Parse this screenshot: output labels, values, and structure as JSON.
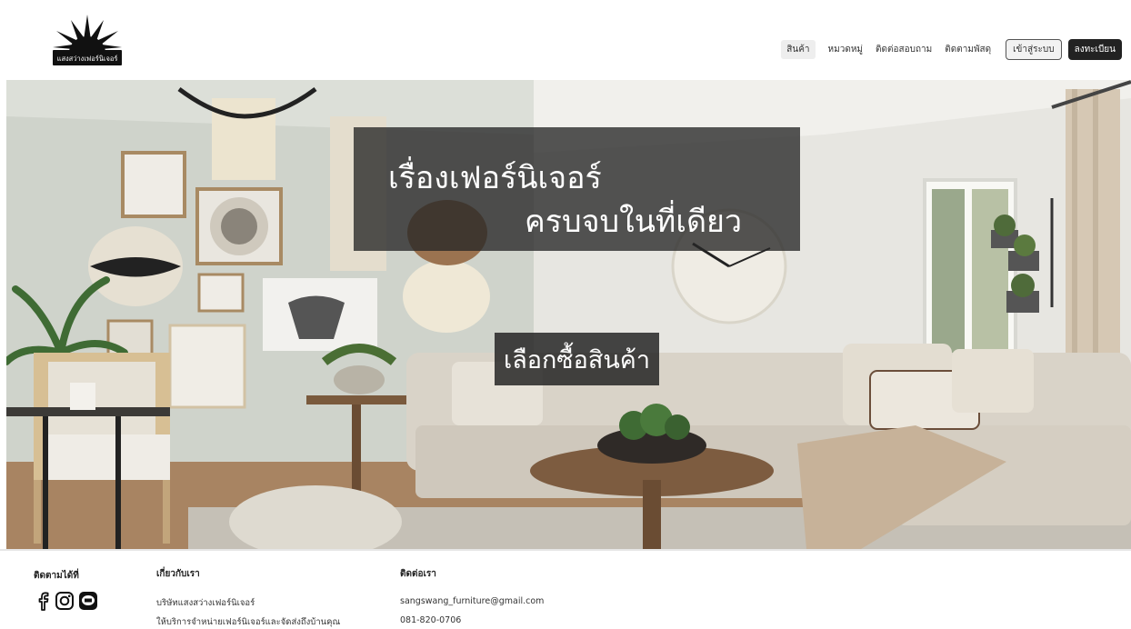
{
  "header": {
    "logo_text": "แสงสว่างเฟอร์นิเจอร์",
    "nav": [
      "สินค้า",
      "หมวดหมู่",
      "ติดต่อสอบถาม",
      "ติดตามพัสดุ"
    ],
    "login_label": "เข้าสู่ระบบ",
    "register_label": "ลงทะเบียน"
  },
  "hero": {
    "headline_line1": "เรื่องเฟอร์นิเจอร์",
    "headline_line2": "ครบจบในที่เดียว",
    "cta_label": "เลือกซื้อสินค้า"
  },
  "footer": {
    "follow_title": "ติดตามได้ที่",
    "social_icons": [
      "facebook-icon",
      "instagram-icon",
      "line-icon"
    ],
    "about_title": "เกี่ยวกับเรา",
    "about_line1": "บริษัทแสงสว่างเฟอร์นิเจอร์",
    "about_line2": "ให้บริการจำหน่ายเฟอร์นิเจอร์และจัดส่งถึงบ้านคุณ",
    "contact_title": "ติดต่อเรา",
    "email": "sangswang_furniture@gmail.com",
    "phone": "081-820-0706"
  },
  "colors": {
    "accent_dark": "#222222",
    "overlay": "#262626",
    "wall": "#d9ddd6",
    "sofa": "#cfc8bc"
  }
}
